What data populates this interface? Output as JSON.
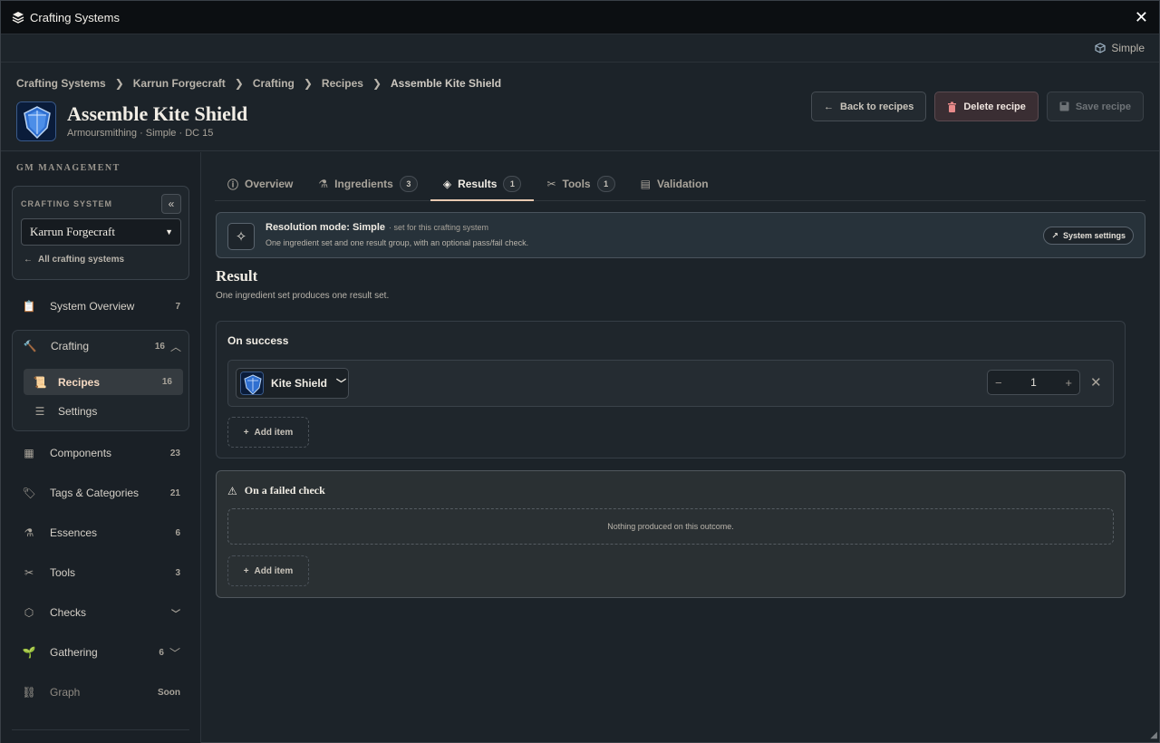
{
  "window": {
    "title": "Crafting Systems",
    "close_icon": "close-icon"
  },
  "mode": {
    "label": "Simple"
  },
  "breadcrumb": [
    "Crafting Systems",
    "Karrun Forgecraft",
    "Crafting",
    "Recipes",
    "Assemble Kite Shield"
  ],
  "recipe": {
    "title": "Assemble Kite Shield",
    "subtitle": "Armoursmithing · Simple · DC 15"
  },
  "actions": {
    "back": "Back to recipes",
    "delete": "Delete recipe",
    "save": "Save recipe"
  },
  "sidebar": {
    "section_label": "GM MANAGEMENT",
    "crafting_system_label": "CRAFTING SYSTEM",
    "crafting_system_value": "Karrun Forgecraft",
    "all_systems_link": "All crafting systems",
    "items": [
      {
        "label": "System Overview",
        "count": "7"
      },
      {
        "label": "Crafting",
        "count": "16"
      },
      {
        "label": "Recipes",
        "count": "16"
      },
      {
        "label": "Settings",
        "count": ""
      },
      {
        "label": "Components",
        "count": "23"
      },
      {
        "label": "Tags & Categories",
        "count": "21"
      },
      {
        "label": "Essences",
        "count": "6"
      },
      {
        "label": "Tools",
        "count": "3"
      },
      {
        "label": "Checks",
        "count": ""
      },
      {
        "label": "Gathering",
        "count": "6"
      },
      {
        "label": "Graph",
        "count": "Soon"
      }
    ]
  },
  "tabs": [
    {
      "label": "Overview",
      "badge": ""
    },
    {
      "label": "Ingredients",
      "badge": "3"
    },
    {
      "label": "Results",
      "badge": "1"
    },
    {
      "label": "Tools",
      "badge": "1"
    },
    {
      "label": "Validation",
      "badge": ""
    }
  ],
  "banner": {
    "title": "Resolution mode: Simple",
    "note": "· set for this crafting system",
    "description": "One ingredient set and one result group, with an optional pass/fail check.",
    "settings_button": "System settings"
  },
  "result": {
    "title": "Result",
    "subtitle": "One ingredient set produces one result set.",
    "success": {
      "title": "On success",
      "item_name": "Kite Shield",
      "quantity": "1",
      "add_label": "Add item"
    },
    "fail": {
      "title": "On a failed check",
      "empty_text": "Nothing produced on this outcome.",
      "add_label": "Add item"
    }
  },
  "colors": {
    "accent": "#e8c9b0",
    "danger_bg": "#3a2e33",
    "background": "#1c2329"
  }
}
